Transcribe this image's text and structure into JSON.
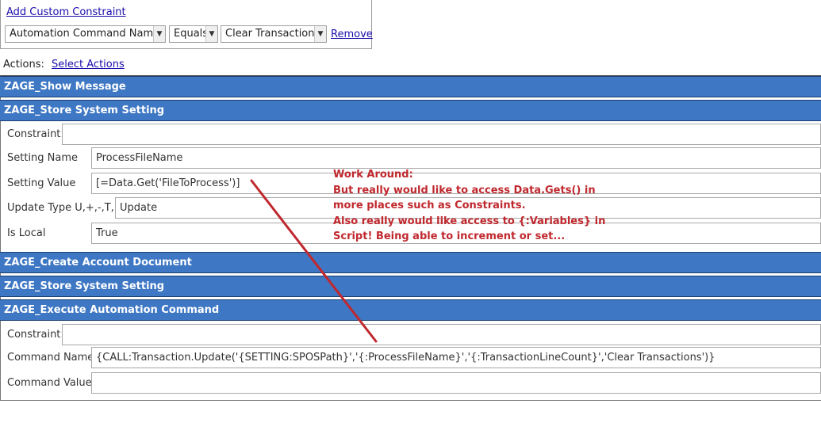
{
  "constraint": {
    "add_link": "Add Custom Constraint",
    "field_select": "Automation Command Name",
    "operator_select": "Equals",
    "value_select": "Clear Transactions",
    "remove_link": "Remove"
  },
  "actions": {
    "label": "Actions:",
    "select_link": "Select Actions"
  },
  "action_items": [
    {
      "title": "ZAGE_Show Message"
    },
    {
      "title": "ZAGE_Store System Setting",
      "fields": [
        {
          "label": "Constraint:",
          "value": ""
        },
        {
          "label": "Setting Name",
          "value": "ProcessFileName"
        },
        {
          "label": "Setting Value",
          "value": "[=Data.Get('FileToProcess')]"
        },
        {
          "label": "Update Type U,+,-,T,D",
          "value": "Update"
        },
        {
          "label": "Is Local",
          "value": "True"
        }
      ]
    },
    {
      "title": "ZAGE_Create Account Document"
    },
    {
      "title": "ZAGE_Store System Setting"
    },
    {
      "title": "ZAGE_Execute Automation Command",
      "fields": [
        {
          "label": "Constraint:",
          "value": ""
        },
        {
          "label": "Command Name",
          "value": "{CALL:Transaction.Update('{SETTING:SPOSPath}','{:ProcessFileName}','{:TransactionLineCount}','Clear Transactions')}"
        },
        {
          "label": "Command Value",
          "value": ""
        }
      ]
    }
  ],
  "annotation": {
    "lines": [
      "Work Around:",
      "But really would like to access Data.Gets() in",
      "more places such as Constraints.",
      "Also really would like access to {:Variables} in",
      "Script! Being able to increment or set..."
    ],
    "color": "#c0282e"
  },
  "icons": {
    "dropdown": "chevron-down-icon"
  }
}
